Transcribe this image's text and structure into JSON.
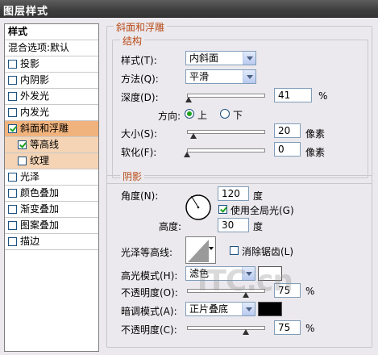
{
  "window": {
    "title": "图层样式"
  },
  "sidebar": {
    "header": "样式",
    "blend_options": "混合选项:默认",
    "items": [
      {
        "label": "投影",
        "checked": false
      },
      {
        "label": "内阴影",
        "checked": false
      },
      {
        "label": "外发光",
        "checked": false
      },
      {
        "label": "内发光",
        "checked": false
      },
      {
        "label": "斜面和浮雕",
        "checked": true,
        "selected": true
      },
      {
        "label": "等高线",
        "checked": true,
        "sub": true
      },
      {
        "label": "纹理",
        "checked": false,
        "sub": true
      },
      {
        "label": "光泽",
        "checked": false
      },
      {
        "label": "颜色叠加",
        "checked": false
      },
      {
        "label": "渐变叠加",
        "checked": false
      },
      {
        "label": "图案叠加",
        "checked": false
      },
      {
        "label": "描边",
        "checked": false
      }
    ]
  },
  "bevel": {
    "section_title": "斜面和浮雕",
    "structure_title": "结构",
    "style_label": "样式(T):",
    "style_value": "内斜面",
    "technique_label": "方法(Q):",
    "technique_value": "平滑",
    "depth_label": "深度(D):",
    "depth_value": "41",
    "depth_unit": "%",
    "depth_level": 0.02,
    "direction_label": "方向:",
    "direction_up": "上",
    "direction_down": "下",
    "direction_selected": "up",
    "size_label": "大小(S):",
    "size_value": "20",
    "size_unit": "像素",
    "size_level": 0.08,
    "soften_label": "软化(F):",
    "soften_value": "0",
    "soften_unit": "像素",
    "soften_level": 0.0
  },
  "shading": {
    "section_title": "阴影",
    "angle_label": "角度(N):",
    "angle_value": "120",
    "angle_unit": "度",
    "global_light_label": "使用全局光(G)",
    "global_light_checked": true,
    "altitude_label": "高度:",
    "altitude_value": "30",
    "altitude_unit": "度",
    "gloss_contour_label": "光泽等高线:",
    "anti_aliased_label": "消除锯齿(L)",
    "anti_aliased_checked": false,
    "highlight_mode_label": "高光模式(H):",
    "highlight_mode_value": "滤色",
    "highlight_color": "#ffffff",
    "highlight_opacity_label": "不透明度(O):",
    "highlight_opacity_value": "75",
    "highlight_opacity_unit": "%",
    "highlight_opacity_level": 0.75,
    "shadow_mode_label": "暗调模式(A):",
    "shadow_mode_value": "正片叠底",
    "shadow_color": "#000000",
    "shadow_opacity_label": "不透明度(C):",
    "shadow_opacity_value": "75",
    "shadow_opacity_unit": "%",
    "shadow_opacity_level": 0.75
  },
  "watermark": "iTC.cn",
  "colors": {
    "accent": "#b84a18",
    "selected_row": "#f1b37d",
    "sub_row": "#f4d4b5"
  }
}
